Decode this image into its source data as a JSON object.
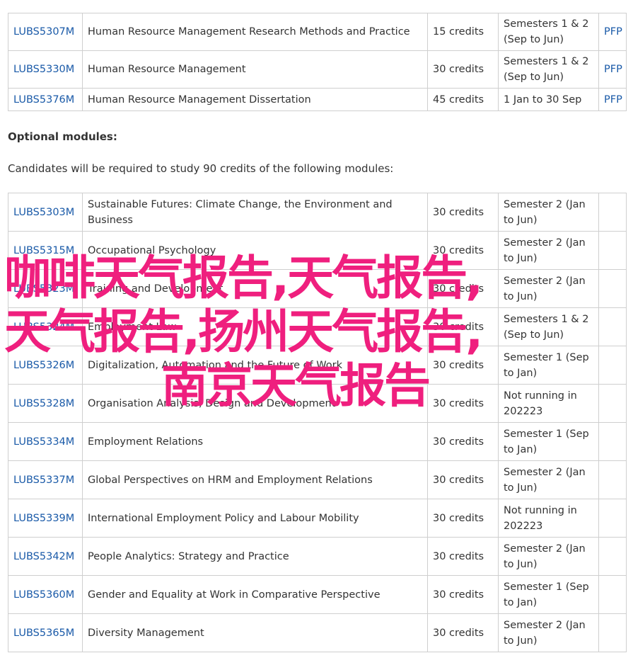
{
  "compulsory_modules": [
    {
      "code": "LUBS5307M",
      "title": "Human Resource Management Research Methods and Practice",
      "credits": "15 credits",
      "semester": "Semesters 1 & 2 (Sep to Jun)",
      "link": "PFP"
    },
    {
      "code": "LUBS5330M",
      "title": "Human Resource Management",
      "credits": "30 credits",
      "semester": "Semesters 1 & 2 (Sep to Jun)",
      "link": "PFP"
    },
    {
      "code": "LUBS5376M",
      "title": "Human Resource Management Dissertation",
      "credits": "45 credits",
      "semester": "1 Jan to 30 Sep",
      "link": "PFP"
    }
  ],
  "optional_section": {
    "heading": "Optional modules:",
    "intro": "Candidates will be required to study 90 credits of the following modules:"
  },
  "optional_modules": [
    {
      "code": "LUBS5303M",
      "title": "Sustainable Futures: Climate Change, the Environment and Business",
      "credits": "30 credits",
      "semester": "Semester 2 (Jan to Jun)"
    },
    {
      "code": "LUBS5315M",
      "title": "Occupational Psychology",
      "credits": "30 credits",
      "semester": "Semester 2 (Jan to Jun)"
    },
    {
      "code": "LUBS5323M",
      "title": "Training and Development",
      "credits": "30 credits",
      "semester": "Semester 2 (Jan to Jun)"
    },
    {
      "code": "LUBS5324M",
      "title": "Employment Law",
      "credits": "30 credits",
      "semester": "Semesters 1 & 2 (Sep to Jun)"
    },
    {
      "code": "LUBS5326M",
      "title": "Digitalization, Automation and the Future of Work",
      "credits": "30 credits",
      "semester": "Semester 1 (Sep to Jan)"
    },
    {
      "code": "LUBS5328M",
      "title": "Organisation Analysis, Design and Development",
      "credits": "30 credits",
      "semester": "Not running in 202223"
    },
    {
      "code": "LUBS5334M",
      "title": "Employment Relations",
      "credits": "30 credits",
      "semester": "Semester 1 (Sep to Jan)"
    },
    {
      "code": "LUBS5337M",
      "title": "Global Perspectives on HRM and Employment Relations",
      "credits": "30 credits",
      "semester": "Semester 2 (Jan to Jun)"
    },
    {
      "code": "LUBS5339M",
      "title": "International Employment Policy and Labour Mobility",
      "credits": "30 credits",
      "semester": "Not running in 202223"
    },
    {
      "code": "LUBS5342M",
      "title": "People Analytics: Strategy and Practice",
      "credits": "30 credits",
      "semester": "Semester 2 (Jan to Jun)"
    },
    {
      "code": "LUBS5360M",
      "title": "Gender and Equality at Work in Comparative Perspective",
      "credits": "30 credits",
      "semester": "Semester 1 (Sep to Jan)"
    },
    {
      "code": "LUBS5365M",
      "title": "Diversity Management",
      "credits": "30 credits",
      "semester": "Semester 2 (Jan to Jun)"
    }
  ],
  "overlay_text": {
    "line1": "咖啡天气报告,天气报告,",
    "line2": "天气报告,扬州天气报告,",
    "line3": "南京天气报告"
  },
  "colors": {
    "link": "#1a5aa8",
    "overlay": "#ef1f7e",
    "border": "#cfcfcf"
  }
}
